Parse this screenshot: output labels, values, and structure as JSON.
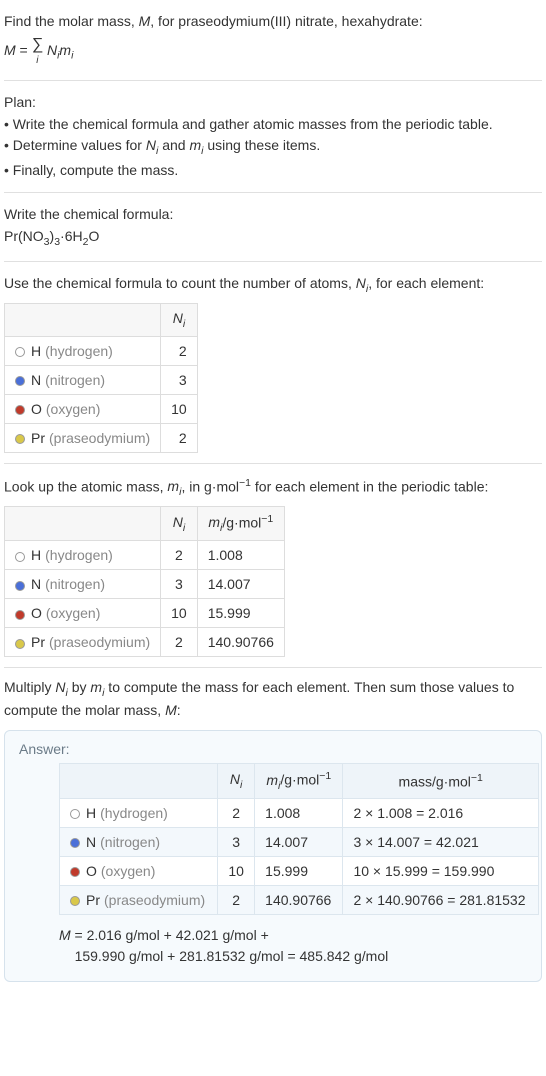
{
  "intro": {
    "prompt": "Find the molar mass, ",
    "prompt2": ", for praseodymium(III) nitrate, hexahydrate:",
    "Mvar": "M",
    "equals": " = ",
    "sigma": "∑",
    "sigma_sub": "i",
    "term": "N",
    "term_sub": "i",
    "term2": "m",
    "term2_sub": "i"
  },
  "plan": {
    "heading": "Plan:",
    "b1": "• Write the chemical formula and gather atomic masses from the periodic table.",
    "b2_a": "• Determine values for ",
    "b2_b": " and ",
    "b2_c": " using these items.",
    "b3": "• Finally, compute the mass."
  },
  "formula_block": {
    "heading": "Write the chemical formula:",
    "compound_parts": [
      "Pr(NO",
      "3",
      ")",
      "3",
      "·6H",
      "2",
      "O"
    ]
  },
  "count_block": {
    "heading_a": "Use the chemical formula to count the number of atoms, ",
    "heading_b": ", for each element:",
    "col_N": "N",
    "col_N_sub": "i"
  },
  "elements": [
    {
      "sym": "H",
      "name": "(hydrogen)",
      "swatch": "#ffffff",
      "N": "2",
      "m": "1.008",
      "mass": "2 × 1.008 = 2.016"
    },
    {
      "sym": "N",
      "name": "(nitrogen)",
      "swatch": "#4a6fd8",
      "N": "3",
      "m": "14.007",
      "mass": "3 × 14.007 = 42.021"
    },
    {
      "sym": "O",
      "name": "(oxygen)",
      "swatch": "#c03a2b",
      "N": "10",
      "m": "15.999",
      "mass": "10 × 15.999 = 159.990"
    },
    {
      "sym": "Pr",
      "name": "(praseodymium)",
      "swatch": "#d9c84a",
      "N": "2",
      "m": "140.90766",
      "mass": "2 × 140.90766 = 281.81532"
    }
  ],
  "mass_block": {
    "heading_a": "Look up the atomic mass, ",
    "heading_b": ", in g·mol",
    "heading_c": " for each element in the periodic table:",
    "sup": "−1",
    "col_m": "m",
    "col_m_sub": "i",
    "col_m_unit_a": "/g·mol",
    "col_m_unit_sup": "−1"
  },
  "multiply_block": {
    "text_a": "Multiply ",
    "text_b": " by ",
    "text_c": " to compute the mass for each element. Then sum those values to compute the molar mass, ",
    "text_d": ":"
  },
  "answer": {
    "label": "Answer:",
    "col_mass_a": "mass/g·mol",
    "col_mass_sup": "−1",
    "final_a": "M",
    "final_b": " = 2.016 g/mol + 42.021 g/mol +",
    "final_c": "159.990 g/mol + 281.81532 g/mol = 485.842 g/mol"
  }
}
